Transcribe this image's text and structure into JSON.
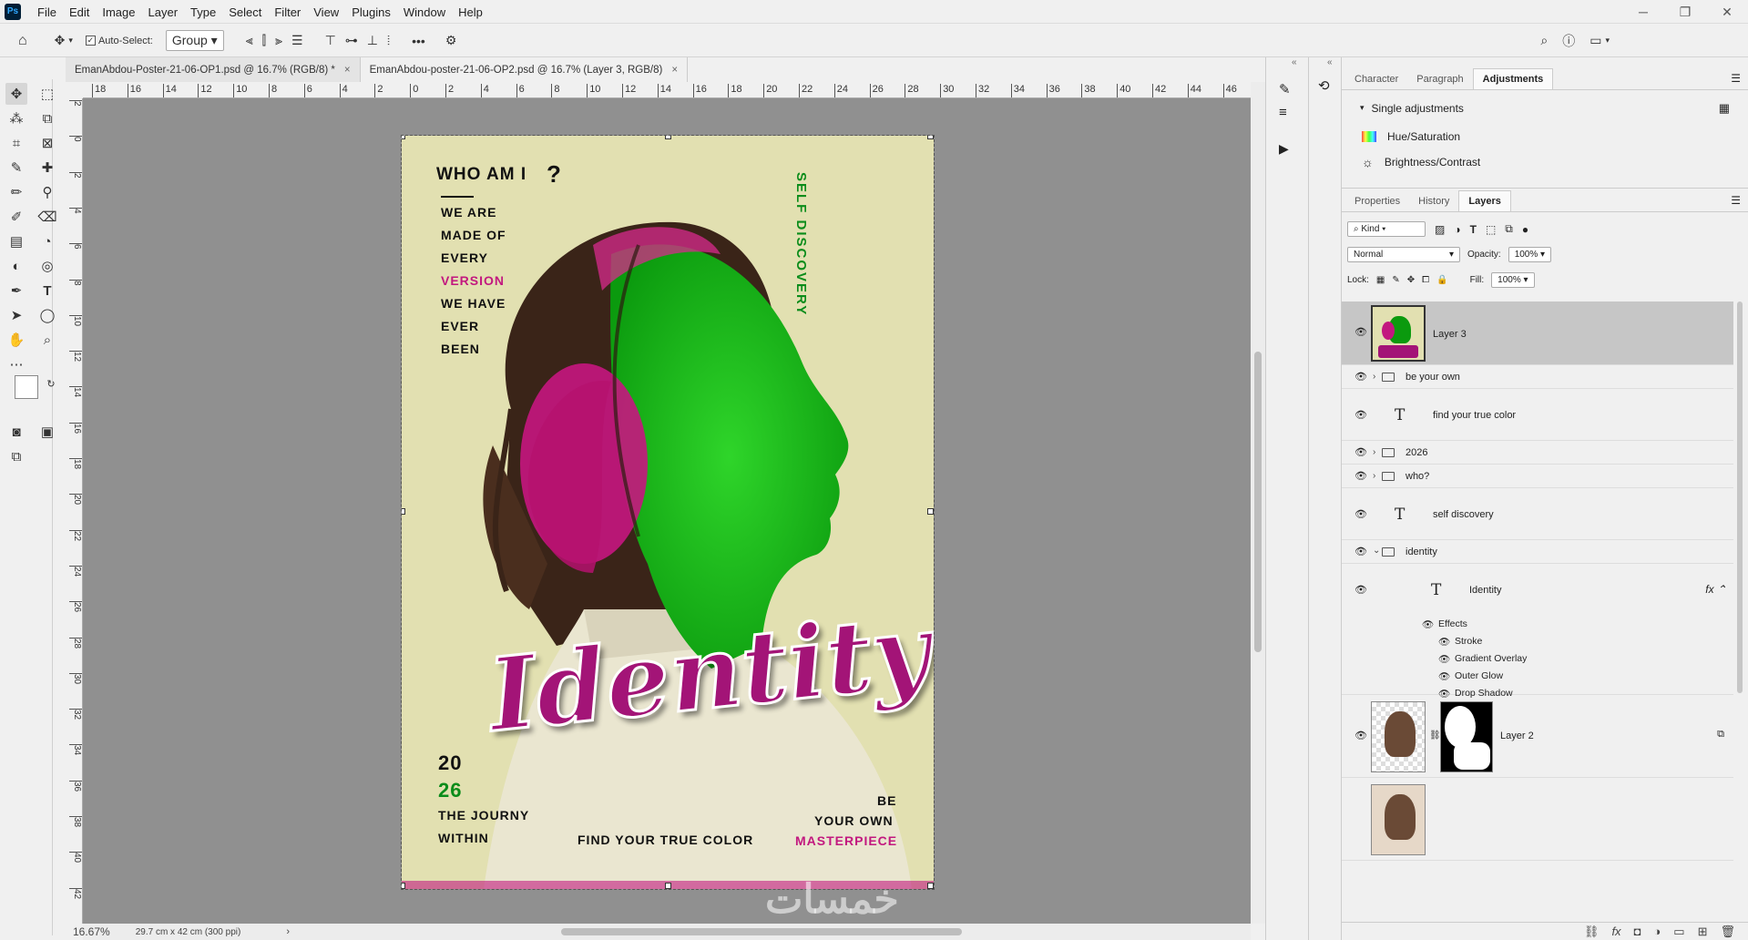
{
  "menu": {
    "items": [
      "File",
      "Edit",
      "Image",
      "Layer",
      "Type",
      "Select",
      "Filter",
      "View",
      "Plugins",
      "Window",
      "Help"
    ]
  },
  "options": {
    "auto_select": "Auto-Select:",
    "group": "Group"
  },
  "doc_tabs": [
    {
      "label": "EmanAbdou-Poster-21-06-OP1.psd @ 16.7% (RGB/8) *",
      "close": "×"
    },
    {
      "label": "EmanAbdou-poster-21-06-OP2.psd @ 16.7% (Layer 3, RGB/8)",
      "close": "×"
    }
  ],
  "ruler": {
    "h": [
      "18",
      "16",
      "14",
      "12",
      "10",
      "8",
      "6",
      "4",
      "2",
      "0",
      "2",
      "4",
      "6",
      "8",
      "10",
      "12",
      "14",
      "16",
      "18",
      "20",
      "22",
      "24",
      "26",
      "28",
      "30",
      "32",
      "34",
      "36",
      "38",
      "40",
      "42",
      "44",
      "46"
    ],
    "v": [
      "2",
      "0",
      "2",
      "4",
      "6",
      "8",
      "10",
      "12",
      "14",
      "16",
      "18",
      "20",
      "22",
      "24",
      "26",
      "28",
      "30",
      "32",
      "34",
      "36",
      "38",
      "40",
      "42"
    ]
  },
  "status": {
    "zoom": "16.67%",
    "size": "29.7 cm x 42 cm (300 ppi)"
  },
  "poster": {
    "who": "WHO AM I",
    "q": "?",
    "lines": [
      "WE ARE",
      "MADE OF",
      "EVERY",
      "VERSION",
      "WE HAVE",
      "EVER",
      "BEEN"
    ],
    "vertical": "SELF DISCOVERY",
    "identity": "Identity",
    "year1": "20",
    "year2": "26",
    "journey1": "THE JOURNY",
    "journey2": "WITHIN",
    "true_color": "FIND YOUR TRUE COLOR",
    "be": "BE",
    "your_own": "YOUR OWN",
    "masterpiece": "MASTERPIECE",
    "watermark": "خمسات"
  },
  "adj_tabs": [
    "Character",
    "Paragraph",
    "Adjustments"
  ],
  "adjustments": {
    "section": "Single adjustments",
    "items": [
      "Hue/Saturation",
      "Brightness/Contrast"
    ]
  },
  "layer_tabs": [
    "Properties",
    "History",
    "Layers"
  ],
  "layers_controls": {
    "kind": "Kind",
    "blend": "Normal",
    "opacity_label": "Opacity:",
    "opacity": "100%",
    "lock_label": "Lock:",
    "fill_label": "Fill:",
    "fill": "100%"
  },
  "layers": [
    {
      "name": "Layer 3"
    },
    {
      "name": "be your own"
    },
    {
      "name": "find your true color"
    },
    {
      "name": "2026"
    },
    {
      "name": "who?"
    },
    {
      "name": "self discovery"
    },
    {
      "name": "identity"
    },
    {
      "name": "Identity"
    },
    {
      "name": "Layer 2"
    }
  ],
  "effects": {
    "title": "Effects",
    "items": [
      "Stroke",
      "Gradient Overlay",
      "Outer Glow",
      "Drop Shadow"
    ]
  },
  "colors": {
    "accent": "#c2187f",
    "green": "#0b8c1a",
    "poster_bg": "#e2e0b1"
  }
}
